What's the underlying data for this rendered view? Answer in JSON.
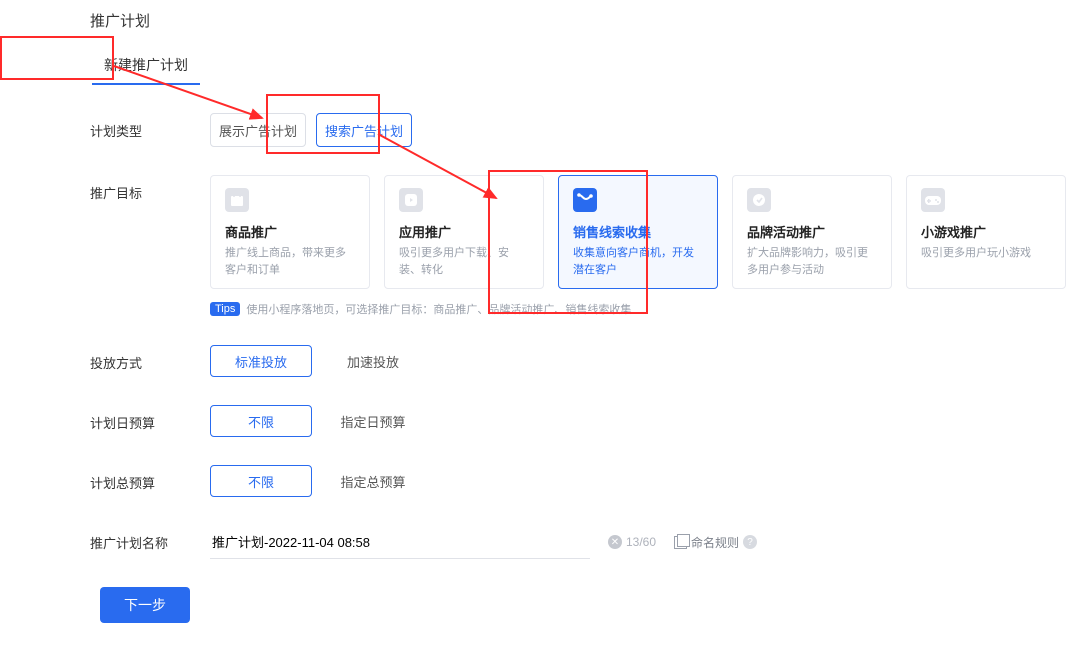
{
  "title": "推广计划",
  "tab_new": "新建推广计划",
  "plan_type": {
    "label": "计划类型",
    "display": "展示广告计划",
    "search": "搜索广告计划"
  },
  "goal": {
    "label": "推广目标",
    "cards": [
      {
        "icon": "bag-icon",
        "title": "商品推广",
        "desc": "推广线上商品，带来更多客户和订单"
      },
      {
        "icon": "app-icon",
        "title": "应用推广",
        "desc": "吸引更多用户下载、安装、转化"
      },
      {
        "icon": "lead-icon",
        "title": "销售线索收集",
        "desc": "收集意向客户商机，开发潜在客户"
      },
      {
        "icon": "brand-icon",
        "title": "品牌活动推广",
        "desc": "扩大品牌影响力，吸引更多用户参与活动"
      },
      {
        "icon": "game-icon",
        "title": "小游戏推广",
        "desc": "吸引更多用户玩小游戏"
      }
    ],
    "tips_badge": "Tips",
    "tips_text": "使用小程序落地页，可选择推广目标：商品推广、品牌活动推广、销售线索收集"
  },
  "delivery": {
    "label": "投放方式",
    "std": "标准投放",
    "fast": "加速投放"
  },
  "daily": {
    "label": "计划日预算",
    "unlimited": "不限",
    "set": "指定日预算"
  },
  "total": {
    "label": "计划总预算",
    "unlimited": "不限",
    "set": "指定总预算"
  },
  "name": {
    "label": "推广计划名称",
    "value": "推广计划-2022-11-04 08:58",
    "counter": "13/60",
    "rule": "命名规则"
  },
  "next": "下一步"
}
